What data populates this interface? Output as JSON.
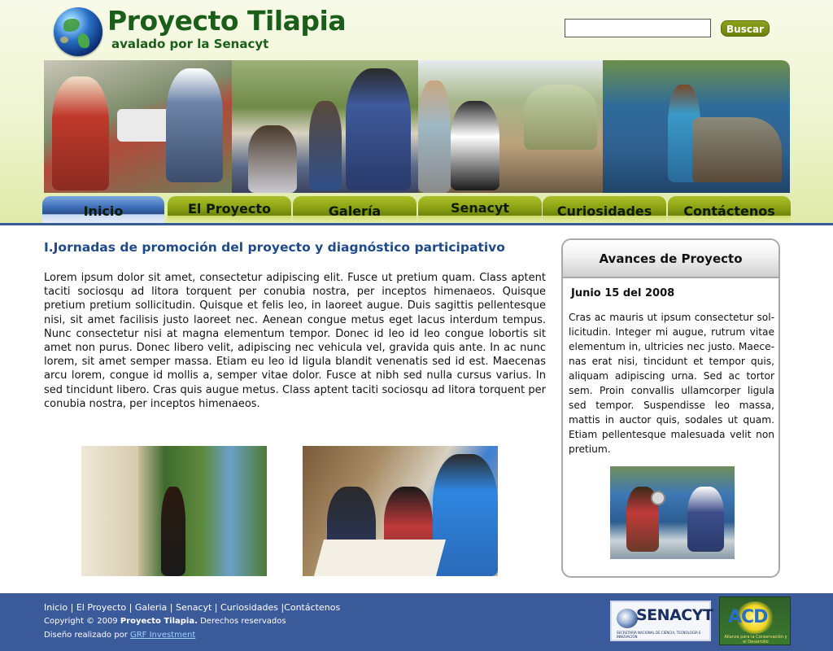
{
  "header": {
    "title": "Proyecto Tilapia",
    "subtitle": "avalado por la Senacyt",
    "search": {
      "placeholder": "",
      "button_label": "Buscar"
    }
  },
  "nav": {
    "tabs": [
      {
        "label": "Inicio",
        "active": true
      },
      {
        "label": "El Proyecto",
        "active": false
      },
      {
        "label": "Galería",
        "active": false
      },
      {
        "label": "Senacyt",
        "active": false
      },
      {
        "label": "Curiosidades",
        "active": false
      },
      {
        "label": "Contáctenos",
        "active": false
      }
    ]
  },
  "main": {
    "title": "I.Jornadas de promoción del proyecto y diagnóstico participativo",
    "body": "Lorem ipsum dolor sit amet, consectetur adipiscing elit. Fusce ut pretium quam. Class aptent taciti sociosqu ad litora torquent per conubia nostra, per inceptos himenaeos. Quisque pretium pretium sollicitudin. Quisque et felis leo, in laoreet augue. Duis sagittis pellentesque nisi, sit amet facilisis justo laoreet nec. Aenean congue metus eget lacus interdum tempus. Nunc consectetur nisi at magna elementum tempor. Donec id leo id leo congue lobortis sit amet non purus. Donec libero velit, adipiscing nec vehicula vel, gravida quis ante. In ac nunc lorem, sit amet semper massa. Etiam eu leo id ligula blan­dit venenatis sed id est. Maecenas arcu lorem, congue id mollis a, semper vitae dolor. Fusce at nibh sed nulla cursus varius. In sed tincidunt libero. Cras quis augue metus. Class aptent taciti sociosqu ad litora torquent per conubia nostra, per incep­tos hime­naeos."
  },
  "sidebar": {
    "title": "Avances de Proyecto",
    "date": "Junio 15 del 2008",
    "text": "Cras ac mauris ut ipsum consectetur sol­licitudin. Integer mi augue, rutrum vitae elementum in, ultricies nec justo. Maece­nas erat nisi, tincidunt et tempor quis, aliquam adipiscing urna. Sed ac tortor sem. Proin convallis ullamcorper ligula sed tempor. Suspendisse leo massa, mattis in auctor quis, sodales ut quam. Etiam pellentesque malesuada velit non pretium."
  },
  "footer": {
    "links": [
      "Inicio",
      "El Proyecto",
      "Galeria",
      "Senacyt",
      "Curiosidades",
      "Contáctenos"
    ],
    "copyright_prefix": "Copyright © 2009 ",
    "copyright_brand": "Proyecto Tilapia.",
    "copyright_suffix": " Derechos reservados",
    "design_prefix": "Diseño realizado por ",
    "design_link": "GRF Investment",
    "logos": {
      "senacyt": "SENACYT",
      "senacyt_sub": "SECRETARÍA NACIONAL DE CIENCIA, TECNOLOGÍA E INNOVACIÓN",
      "acd": "ACD",
      "acd_sub": "Alianza para la Conservación y el Desarrollo"
    }
  },
  "colors": {
    "title_green": "#1a5e1a",
    "heading_blue": "#1f4a8a",
    "nav_olive": "#8ea414",
    "nav_active_blue": "#3f6fb8",
    "footer_blue": "#3b5a9a"
  },
  "icons": [
    "globe-logo-icon"
  ]
}
